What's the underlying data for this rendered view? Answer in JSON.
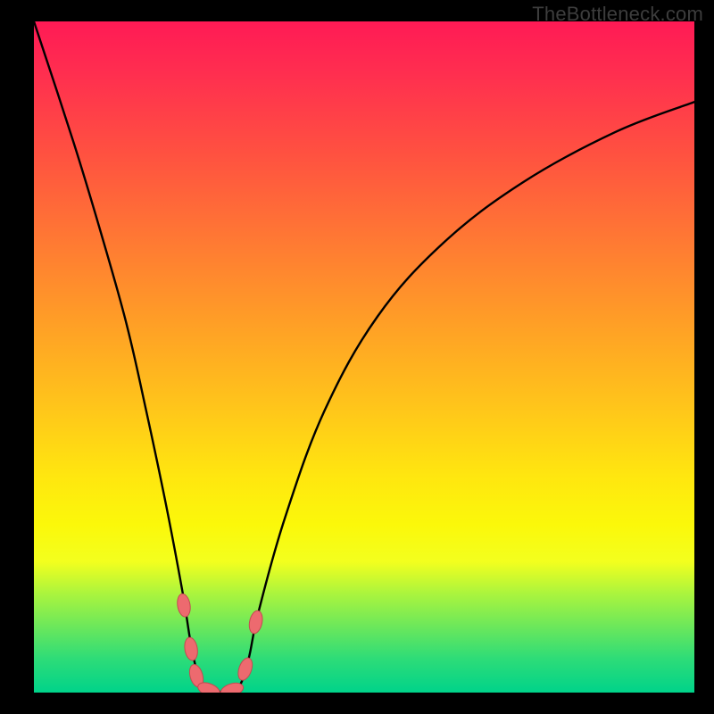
{
  "watermark": "TheBottleneck.com",
  "chart_data": {
    "type": "line",
    "title": "",
    "xlabel": "",
    "ylabel": "",
    "xlim": [
      0,
      100
    ],
    "ylim": [
      0,
      100
    ],
    "series": [
      {
        "name": "bottleneck-curve",
        "x": [
          0,
          6,
          10,
          14,
          17,
          20,
          22.5,
          24,
          25.5,
          27,
          29,
          31,
          32.5,
          34,
          38,
          44,
          52,
          62,
          74,
          88,
          100
        ],
        "values": [
          100,
          82,
          69,
          55,
          42,
          28,
          15,
          6,
          0.8,
          0.2,
          0.2,
          0.8,
          5,
          12,
          26,
          42,
          56,
          67,
          76,
          83.5,
          88
        ]
      }
    ],
    "markers": [
      {
        "name": "left-marker-top",
        "x": 22.7,
        "y": 13.0
      },
      {
        "name": "left-marker-mid",
        "x": 23.8,
        "y": 6.5
      },
      {
        "name": "left-marker-low",
        "x": 24.6,
        "y": 2.5
      },
      {
        "name": "valley-left",
        "x": 26.5,
        "y": 0.4
      },
      {
        "name": "valley-right",
        "x": 30.0,
        "y": 0.4
      },
      {
        "name": "right-marker-low",
        "x": 32.0,
        "y": 3.5
      },
      {
        "name": "right-marker-top",
        "x": 33.6,
        "y": 10.5
      }
    ],
    "marker_style": {
      "fill": "#ed6a6f",
      "stroke": "#c24b51",
      "rx": 7,
      "ry": 13
    },
    "gradient_stops": [
      {
        "pos": 0,
        "color": "#ff1a55"
      },
      {
        "pos": 0.33,
        "color": "#ff7a33"
      },
      {
        "pos": 0.68,
        "color": "#ffe70f"
      },
      {
        "pos": 1.0,
        "color": "#00d38a"
      }
    ]
  }
}
